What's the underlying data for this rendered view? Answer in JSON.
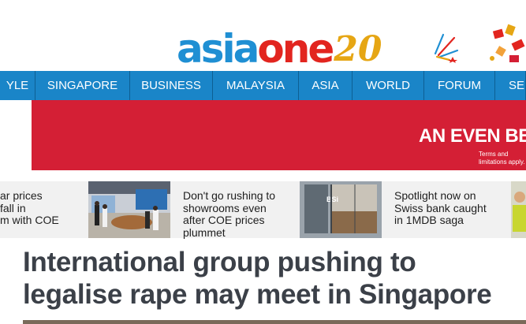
{
  "logo": {
    "part1": "asia",
    "part2": "one",
    "anniversary": "20"
  },
  "nav": {
    "items": [
      {
        "label": "YLE",
        "width": 45
      },
      {
        "label": "SINGAPORE",
        "width": 120
      },
      {
        "label": "BUSINESS",
        "width": 105
      },
      {
        "label": "MALAYSIA",
        "width": 109
      },
      {
        "label": "ASIA",
        "width": 68
      },
      {
        "label": "WORLD",
        "width": 91
      },
      {
        "label": "FORUM",
        "width": 90
      },
      {
        "label": "SER",
        "width": 39
      }
    ]
  },
  "ad": {
    "headline": "AN EVEN BE",
    "terms_line1": "Terms and",
    "terms_line2": "limitations apply."
  },
  "related": [
    {
      "lines": [
        "ar prices",
        "fall in",
        "m with COE"
      ]
    },
    {
      "lines": [
        "Don't go rushing to",
        "showrooms even",
        "after COE prices",
        "plummet"
      ]
    },
    {
      "lines": [
        "Spotlight now on",
        "Swiss bank caught",
        "in 1MDB saga"
      ]
    }
  ],
  "article": {
    "title": "International group pushing to legalise rape may meet in Singapore"
  }
}
